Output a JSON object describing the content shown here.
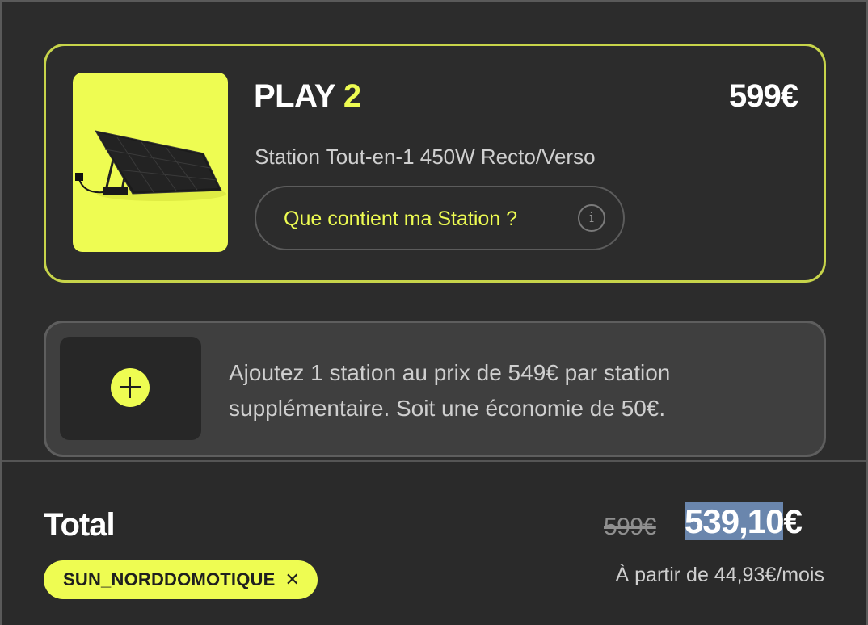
{
  "product": {
    "name": "PLAY",
    "name_number": "2",
    "price": "599€",
    "description": "Station Tout-en-1 450W Recto/Verso",
    "contents_button_label": "Que contient ma Station ?",
    "info_icon_glyph": "i",
    "accent_color": "#eefc52"
  },
  "addon": {
    "text": "Ajoutez 1 station au prix de 549€ par station supplémentaire. Soit une économie de 50€."
  },
  "total": {
    "label": "Total",
    "old_price": "599€",
    "new_price_selected": "539,10",
    "new_price_currency": "€",
    "monthly": "À partir de 44,93€/mois",
    "promo_code": "SUN_NORDDOMOTIQUE",
    "promo_remove_glyph": "✕"
  }
}
